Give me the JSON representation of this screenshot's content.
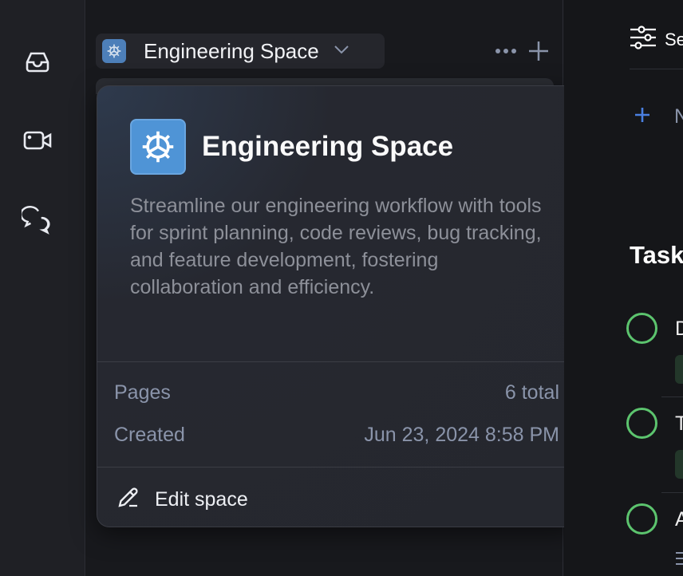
{
  "rail": {
    "items": [
      {
        "icon": "inbox-icon"
      },
      {
        "icon": "video-icon"
      },
      {
        "icon": "chat-icon"
      }
    ]
  },
  "space_switcher": {
    "name": "Engineering Space",
    "icon": "gear-icon"
  },
  "popover": {
    "title": "Engineering Space",
    "description": "Streamline our engineering workflow with tools for sprint planning, code reviews, bug tracking, and feature development, fostering collaboration and efficiency.",
    "pages_label": "Pages",
    "pages_value": "6 total",
    "created_label": "Created",
    "created_value": "Jun 23, 2024 8:58 PM",
    "edit_label": "Edit space"
  },
  "main": {
    "settings_label": "Se",
    "new_label": "N",
    "tasks_heading": "Task",
    "tasks": [
      {
        "title": "D"
      },
      {
        "title": "T"
      },
      {
        "title": "A"
      }
    ]
  },
  "colors": {
    "accent": "#4f94d6",
    "task_circle": "#5cc46e",
    "plus": "#4a7fe0"
  }
}
